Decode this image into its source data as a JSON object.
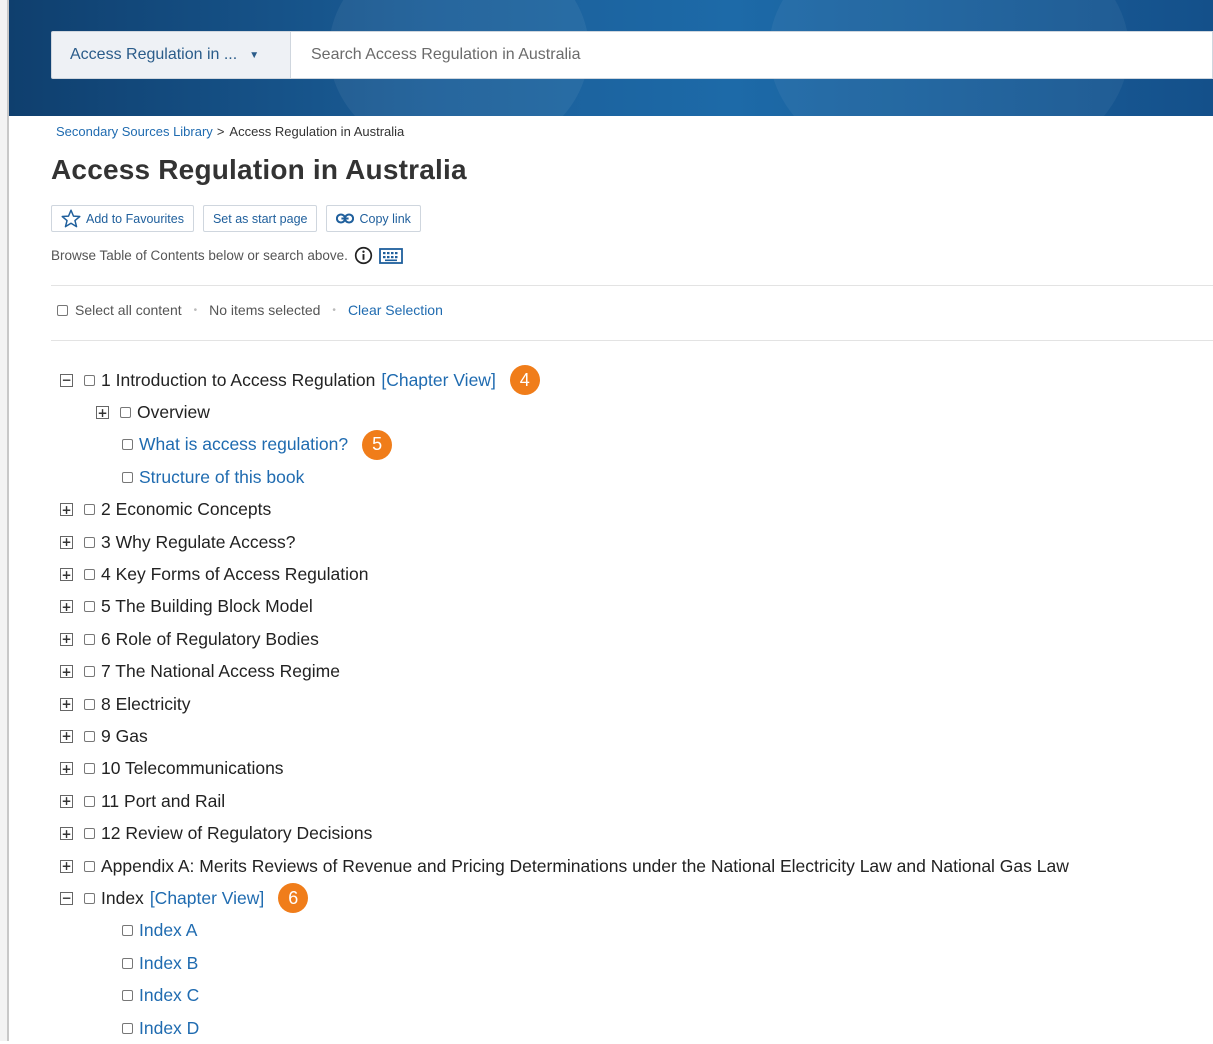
{
  "header": {
    "scope_label": "Access Regulation in ...",
    "search_placeholder": "Search Access Regulation in Australia"
  },
  "breadcrumb": {
    "library": "Secondary Sources Library",
    "separator": ">",
    "current": "Access Regulation in Australia"
  },
  "page_title": "Access Regulation in Australia",
  "actions": {
    "favourite": "Add to Favourites",
    "start_page": "Set as start page",
    "copy_link": "Copy link"
  },
  "browse_hint": "Browse Table of Contents below or search above.",
  "selection": {
    "select_all": "Select all content",
    "status": "No items selected",
    "clear": "Clear Selection"
  },
  "toc": {
    "chapter_view": "[Chapter View]",
    "items": [
      {
        "label": "1 Introduction to Access Regulation",
        "marker": "4"
      },
      {
        "label": "Overview"
      },
      {
        "label": "What is access regulation?",
        "marker": "5"
      },
      {
        "label": "Structure of this book"
      },
      {
        "label": "2 Economic Concepts"
      },
      {
        "label": "3 Why Regulate Access?"
      },
      {
        "label": "4 Key Forms of Access Regulation"
      },
      {
        "label": "5 The Building Block Model"
      },
      {
        "label": "6 Role of Regulatory Bodies"
      },
      {
        "label": "7 The National Access Regime"
      },
      {
        "label": "8 Electricity"
      },
      {
        "label": "9 Gas"
      },
      {
        "label": "10 Telecommunications"
      },
      {
        "label": "11 Port and Rail"
      },
      {
        "label": "12 Review of Regulatory Decisions"
      },
      {
        "label": "Appendix A: Merits Reviews of Revenue and Pricing Determinations under the National Electricity Law and National Gas Law"
      },
      {
        "label": "Index",
        "marker": "6"
      },
      {
        "label": "Index A"
      },
      {
        "label": "Index B"
      },
      {
        "label": "Index C"
      },
      {
        "label": "Index D"
      }
    ]
  },
  "colors": {
    "link": "#1f6bb0",
    "banner": "#1a5d97",
    "marker": "#f07d1a"
  }
}
